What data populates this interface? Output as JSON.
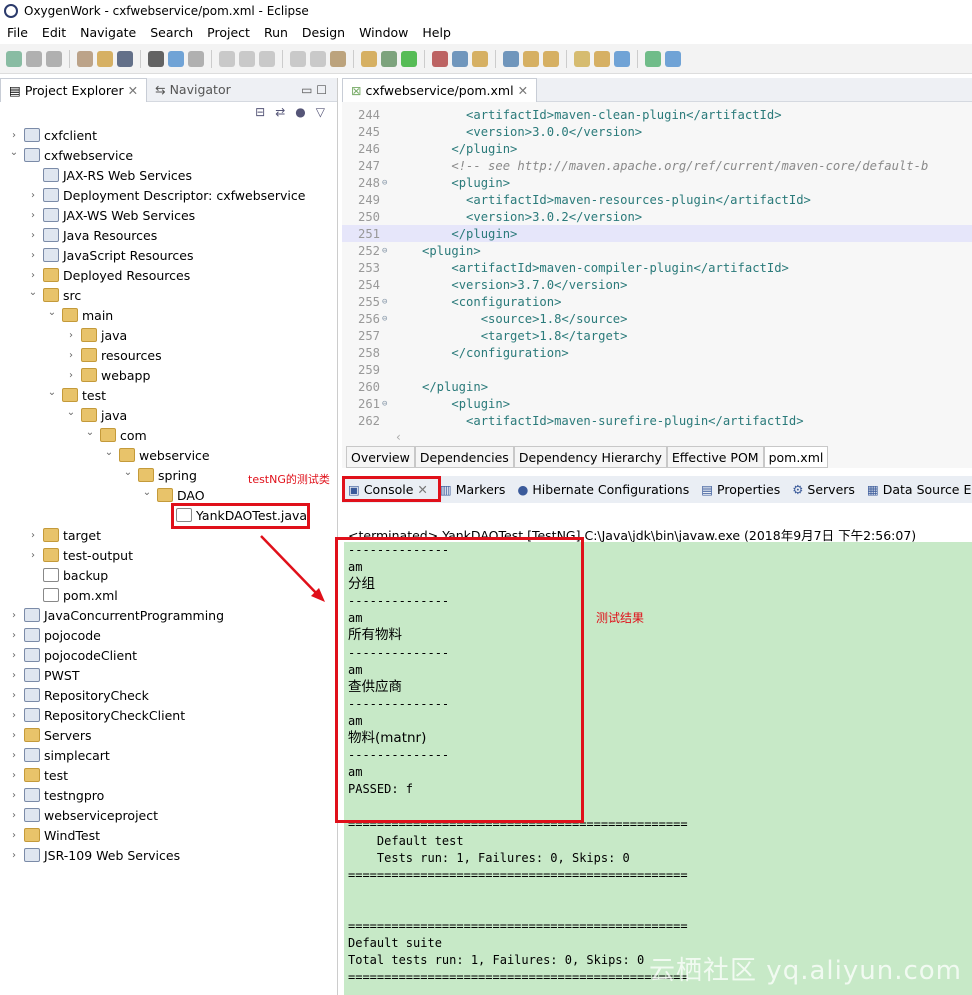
{
  "window": {
    "title": "OxygenWork - cxfwebservice/pom.xml - Eclipse"
  },
  "menu": [
    "File",
    "Edit",
    "Navigate",
    "Search",
    "Project",
    "Run",
    "Design",
    "Window",
    "Help"
  ],
  "left_panel": {
    "tabs": [
      "Project Explorer",
      "Navigator"
    ],
    "tree": [
      {
        "label": "cxfclient",
        "level": 0,
        "state": "collapsed",
        "icon": "project"
      },
      {
        "label": "cxfwebservice",
        "level": 0,
        "state": "expanded",
        "icon": "project"
      },
      {
        "label": "JAX-RS Web Services",
        "level": 1,
        "state": "leaf",
        "icon": "ws"
      },
      {
        "label": "Deployment Descriptor: cxfwebservice",
        "level": 1,
        "state": "collapsed",
        "icon": "dd"
      },
      {
        "label": "JAX-WS Web Services",
        "level": 1,
        "state": "collapsed",
        "icon": "ws"
      },
      {
        "label": "Java Resources",
        "level": 1,
        "state": "collapsed",
        "icon": "jres"
      },
      {
        "label": "JavaScript Resources",
        "level": 1,
        "state": "collapsed",
        "icon": "jsres"
      },
      {
        "label": "Deployed Resources",
        "level": 1,
        "state": "collapsed",
        "icon": "folder"
      },
      {
        "label": "src",
        "level": 1,
        "state": "expanded",
        "icon": "folder"
      },
      {
        "label": "main",
        "level": 2,
        "state": "expanded",
        "icon": "folder"
      },
      {
        "label": "java",
        "level": 3,
        "state": "collapsed",
        "icon": "folder"
      },
      {
        "label": "resources",
        "level": 3,
        "state": "collapsed",
        "icon": "folder"
      },
      {
        "label": "webapp",
        "level": 3,
        "state": "collapsed",
        "icon": "folder"
      },
      {
        "label": "test",
        "level": 2,
        "state": "expanded",
        "icon": "folder"
      },
      {
        "label": "java",
        "level": 3,
        "state": "expanded",
        "icon": "folder"
      },
      {
        "label": "com",
        "level": 4,
        "state": "expanded",
        "icon": "folder"
      },
      {
        "label": "webservice",
        "level": 5,
        "state": "expanded",
        "icon": "folder"
      },
      {
        "label": "spring",
        "level": 6,
        "state": "expanded",
        "icon": "folder"
      },
      {
        "label": "DAO",
        "level": 7,
        "state": "expanded",
        "icon": "folder"
      },
      {
        "label": "YankDAOTest.java",
        "level": 8,
        "state": "leaf",
        "icon": "file"
      },
      {
        "label": "target",
        "level": 1,
        "state": "collapsed",
        "icon": "folder"
      },
      {
        "label": "test-output",
        "level": 1,
        "state": "collapsed",
        "icon": "folder"
      },
      {
        "label": "backup",
        "level": 1,
        "state": "leaf",
        "icon": "file"
      },
      {
        "label": "pom.xml",
        "level": 1,
        "state": "leaf",
        "icon": "file"
      },
      {
        "label": "JavaConcurrentProgramming",
        "level": 0,
        "state": "collapsed",
        "icon": "project"
      },
      {
        "label": "pojocode",
        "level": 0,
        "state": "collapsed",
        "icon": "project"
      },
      {
        "label": "pojocodeClient",
        "level": 0,
        "state": "collapsed",
        "icon": "project"
      },
      {
        "label": "PWST",
        "level": 0,
        "state": "collapsed",
        "icon": "project"
      },
      {
        "label": "RepositoryCheck",
        "level": 0,
        "state": "collapsed",
        "icon": "project"
      },
      {
        "label": "RepositoryCheckClient",
        "level": 0,
        "state": "collapsed",
        "icon": "project"
      },
      {
        "label": "Servers",
        "level": 0,
        "state": "collapsed",
        "icon": "folder"
      },
      {
        "label": "simplecart",
        "level": 0,
        "state": "collapsed",
        "icon": "project"
      },
      {
        "label": "test",
        "level": 0,
        "state": "collapsed",
        "icon": "folder"
      },
      {
        "label": "testngpro",
        "level": 0,
        "state": "collapsed",
        "icon": "project"
      },
      {
        "label": "webserviceproject",
        "level": 0,
        "state": "collapsed",
        "icon": "project"
      },
      {
        "label": "WindTest",
        "level": 0,
        "state": "collapsed",
        "icon": "folder"
      },
      {
        "label": "JSR-109 Web Services",
        "level": 0,
        "state": "collapsed",
        "icon": "ws"
      }
    ]
  },
  "annotations": {
    "testng_class": "testNG的测试类",
    "test_result": "测试结果"
  },
  "editor": {
    "tab": "cxfwebservice/pom.xml",
    "lines": [
      {
        "n": "244",
        "indent": "      ",
        "code": "<artifactId>maven-clean-plugin</artifactId>"
      },
      {
        "n": "245",
        "indent": "      ",
        "code": "<version>3.0.0</version>"
      },
      {
        "n": "246",
        "indent": "    ",
        "code": "</plugin>"
      },
      {
        "n": "247",
        "indent": "    ",
        "code": "<!-- see http://maven.apache.org/ref/current/maven-core/default-b",
        "comment": true
      },
      {
        "n": "248",
        "indent": "    ",
        "code": "<plugin>",
        "fold": true
      },
      {
        "n": "249",
        "indent": "      ",
        "code": "<artifactId>maven-resources-plugin</artifactId>"
      },
      {
        "n": "250",
        "indent": "      ",
        "code": "<version>3.0.2</version>"
      },
      {
        "n": "251",
        "indent": "    ",
        "code": "</plugin>",
        "current": true
      },
      {
        "n": "252",
        "indent": "",
        "code": "<plugin>",
        "fold": true
      },
      {
        "n": "253",
        "indent": "    ",
        "code": "<artifactId>maven-compiler-plugin</artifactId>"
      },
      {
        "n": "254",
        "indent": "    ",
        "code": "<version>3.7.0</version>"
      },
      {
        "n": "255",
        "indent": "    ",
        "code": "<configuration>",
        "fold": true
      },
      {
        "n": "256",
        "indent": "        ",
        "code": "<source>1.8</source>",
        "fold": true
      },
      {
        "n": "257",
        "indent": "        ",
        "code": "<target>1.8</target>"
      },
      {
        "n": "258",
        "indent": "    ",
        "code": "</configuration>"
      },
      {
        "n": "259",
        "indent": "",
        "code": ""
      },
      {
        "n": "260",
        "indent": "",
        "code": "</plugin>"
      },
      {
        "n": "261",
        "indent": "    ",
        "code": "<plugin>",
        "fold": true
      },
      {
        "n": "262",
        "indent": "      ",
        "code": "<artifactId>maven-surefire-plugin</artifactId>"
      }
    ],
    "pom_tabs": [
      "Overview",
      "Dependencies",
      "Dependency Hierarchy",
      "Effective POM",
      "pom.xml"
    ]
  },
  "console": {
    "tabs": [
      "Console",
      "Markers",
      "Hibernate Configurations",
      "Properties",
      "Servers",
      "Data Source Exp"
    ],
    "status": "<terminated> YankDAOTest [TestNG] C:\\Java\\jdk\\bin\\javaw.exe (2018年9月7日 下午2:56:07)",
    "output": [
      "--------------",
      "am",
      "分组",
      "--------------",
      "am",
      "所有物料",
      "--------------",
      "am",
      "查供应商",
      "--------------",
      "am",
      "物料(matnr)",
      "--------------",
      "am",
      "PASSED: f",
      "",
      "===============================================",
      "    Default test",
      "    Tests run: 1, Failures: 0, Skips: 0",
      "===============================================",
      "",
      "",
      "===============================================",
      "Default suite",
      "Total tests run: 1, Failures: 0, Skips: 0",
      "==============================================="
    ]
  },
  "watermark": "云栖社区 yq.aliyun.com",
  "colors": {
    "console_bg": "#c7e9c7",
    "highlight_box": "#e0101a",
    "current_line": "#e6e6fa"
  }
}
